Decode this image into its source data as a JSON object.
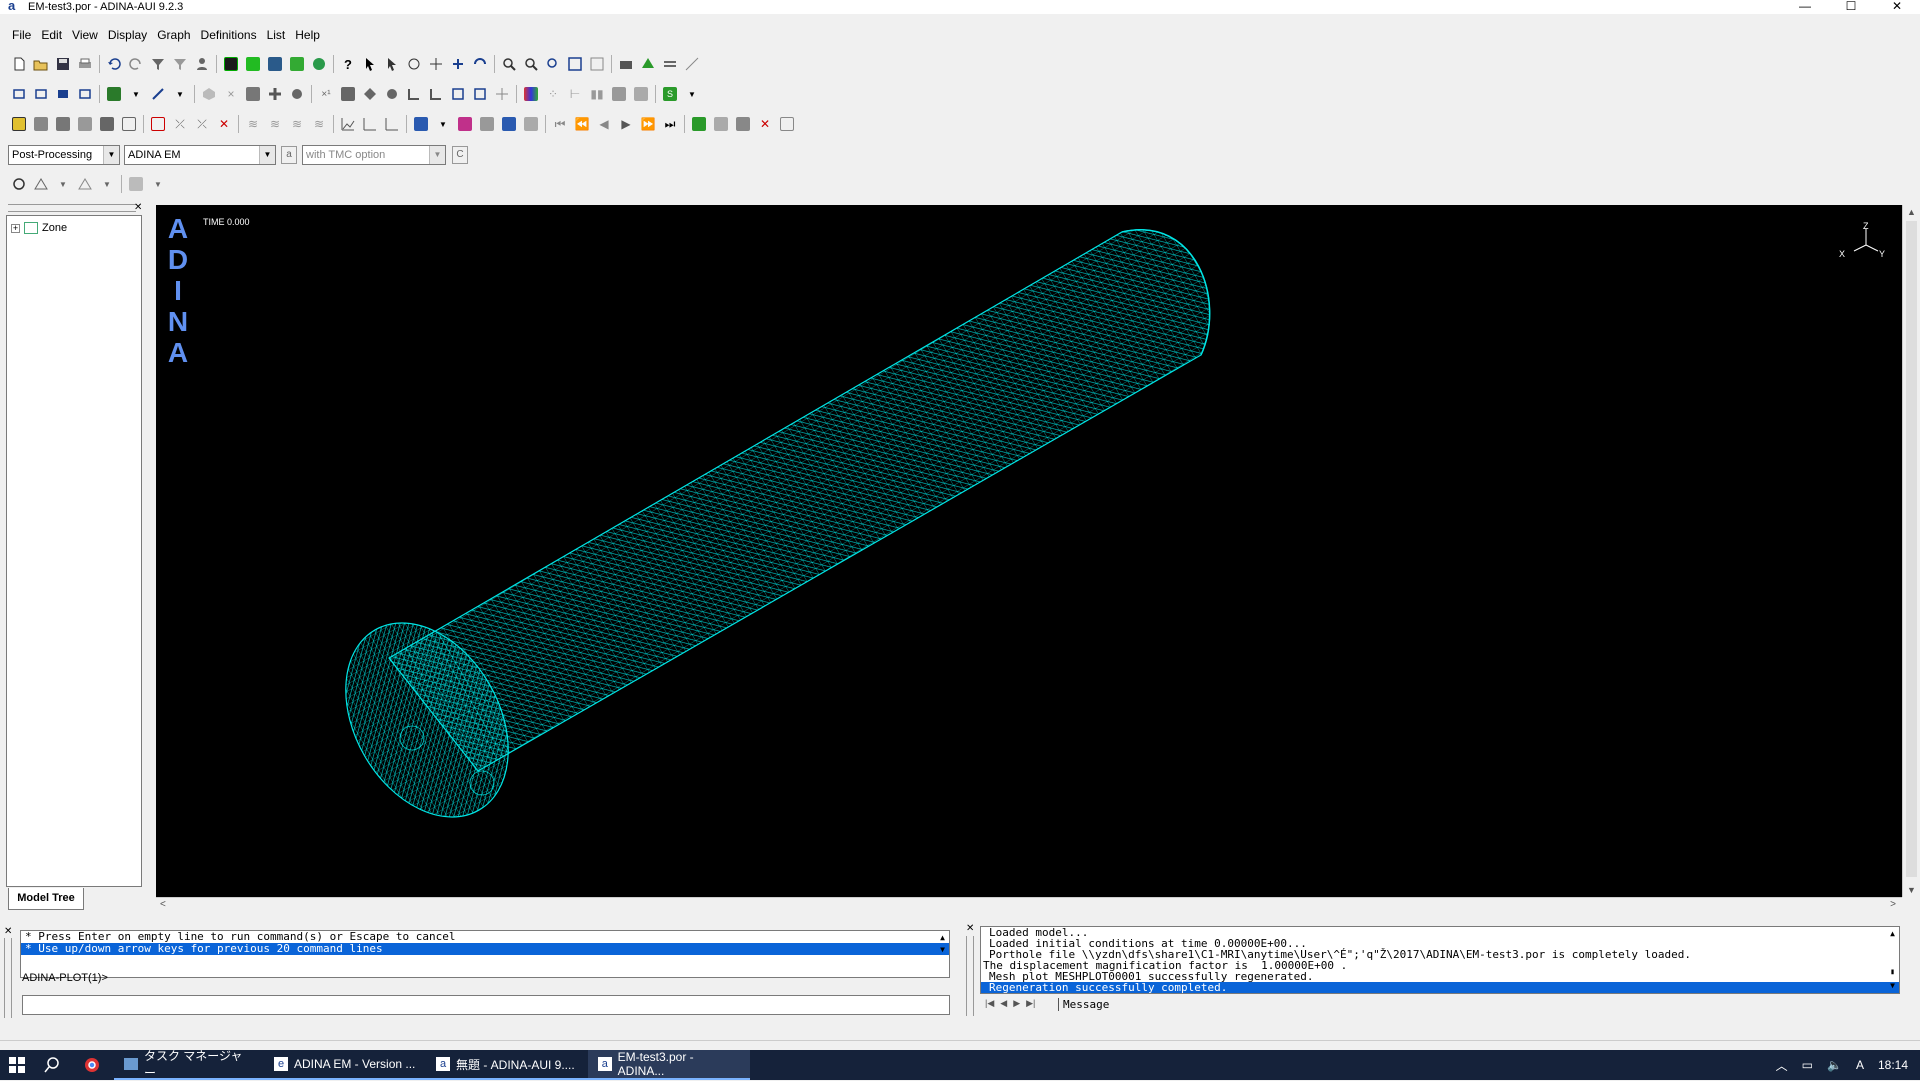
{
  "window": {
    "title": "EM-test3.por - ADINA-AUI  9.2.3",
    "app_icon_glyph": "a",
    "minimize_glyph": "—",
    "maximize_glyph": "☐",
    "close_glyph": "✕"
  },
  "menu": [
    "File",
    "Edit",
    "View",
    "Display",
    "Graph",
    "Definitions",
    "List",
    "Help"
  ],
  "mode_combo": "Post-Processing",
  "program_combo": "ADINA EM",
  "option_combo": "with TMC option",
  "model_tree": {
    "items": [
      {
        "label": "Zone",
        "expand_glyph": "+"
      }
    ],
    "tab_label": "Model Tree"
  },
  "viewport": {
    "logo_letters": [
      "A",
      "D",
      "I",
      "N",
      "A"
    ],
    "time_label": "TIME 0.000",
    "axis_labels": {
      "z": "Z",
      "x": "X",
      "y": "Y"
    },
    "mesh_color": "#00e5e5"
  },
  "command": {
    "help_lines": [
      "* Press Enter on empty line to run command(s) or Escape to cancel",
      "* Use up/down arrow keys for previous 20 command lines"
    ],
    "prompt": "ADINA-PLOT(1)>"
  },
  "messages": {
    "lines": [
      "Loaded model...",
      "Loaded initial conditions at time 0.00000E+00...",
      "Porthole file \\\\yzdn\\dfs\\share1\\C1-MRI\\anytime\\User\\^É\";'q\"Ž\\2017\\ADINA\\EM-test3.por is completely loaded.",
      "The displacement magnification factor is  1.00000E+00 .",
      "Mesh plot MESHPLOT00001 successfully regenerated.",
      "Regeneration successfully completed."
    ],
    "tab_label": "Message"
  },
  "taskbar": {
    "tasks": [
      {
        "label": "タスク マネージャー"
      },
      {
        "label": "ADINA EM - Version ..."
      },
      {
        "label": "無題 - ADINA-AUI 9...."
      },
      {
        "label": "EM-test3.por - ADINA..."
      }
    ],
    "ime_glyph": "A",
    "clock": "18:14"
  }
}
